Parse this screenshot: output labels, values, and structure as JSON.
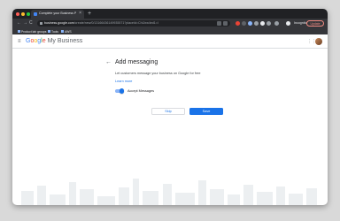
{
  "browser": {
    "tab_title": "Complete your Business Profi",
    "tab_close": "×",
    "new_tab": "+",
    "nav": {
      "back": "←",
      "forward": "→",
      "reload": "C"
    },
    "url_domain": "business.google.com",
    "url_path": "/create/new/0/13166436149935571?placeId=ChIJxw4ed1=l",
    "profile_label": "Incognito",
    "update_label": "Update",
    "bookmarks": [
      "Product lab groups",
      "Tools",
      "AWS"
    ]
  },
  "app": {
    "menu_icon": "≡",
    "logo": {
      "g": "G",
      "o1": "o",
      "o2": "o",
      "g2": "g",
      "l": "l",
      "e": "e",
      "product": " My Business"
    },
    "apps_icon": "⋮⋮"
  },
  "main": {
    "back_arrow": "←",
    "title": "Add messaging",
    "description": "Let customers message your business on Google for free",
    "learn_more": "Learn more",
    "toggle": {
      "label": "Accept Messages",
      "on": true
    },
    "skip_button": "Skip",
    "save_button": "Save"
  },
  "colors": {
    "accent": "#1a73e8",
    "toggle_track": "#8ab4f8",
    "browser_chrome": "#35363a"
  }
}
